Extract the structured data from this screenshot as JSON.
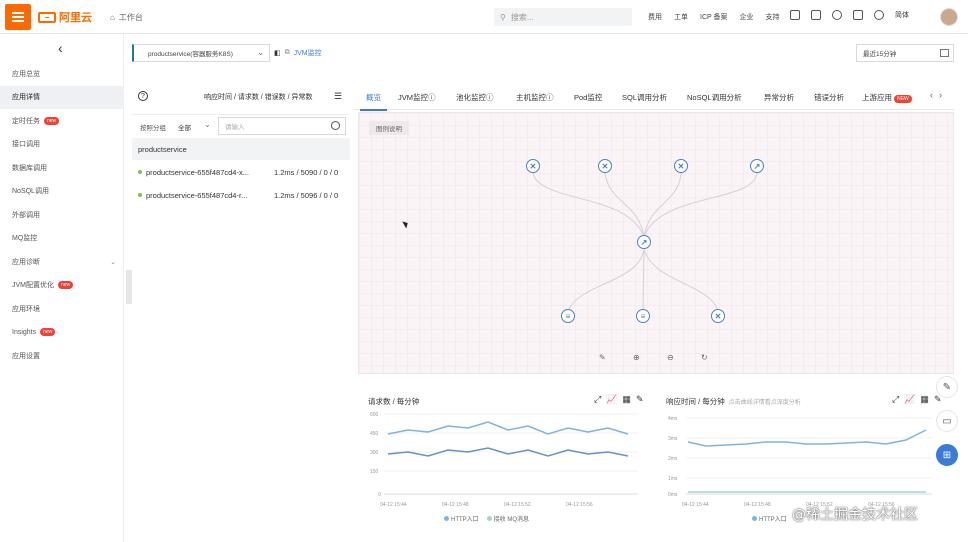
{
  "topbar": {
    "logo_text": "阿里云",
    "workbench": "工作台",
    "search_placeholder": "搜索...",
    "links": [
      "费用",
      "工单",
      "ICP 备案",
      "企业",
      "支持"
    ],
    "lang": "简体"
  },
  "sidebar": {
    "items": [
      {
        "label": "应用总览",
        "badge": "",
        "active": false
      },
      {
        "label": "应用详情",
        "badge": "",
        "active": true
      },
      {
        "label": "定时任务",
        "badge": "new",
        "active": false
      },
      {
        "label": "接口调用",
        "badge": "",
        "active": false
      },
      {
        "label": "数据库调用",
        "badge": "",
        "active": false
      },
      {
        "label": "NoSQL调用",
        "badge": "",
        "active": false
      },
      {
        "label": "外部调用",
        "badge": "",
        "active": false
      },
      {
        "label": "MQ监控",
        "badge": "",
        "active": false
      },
      {
        "label": "应用诊断",
        "badge": "",
        "active": false
      },
      {
        "label": "JVM配置优化",
        "badge": "new",
        "active": false
      },
      {
        "label": "应用环境",
        "badge": "",
        "active": false
      },
      {
        "label": "Insights",
        "badge": "new",
        "active": false
      },
      {
        "label": "应用设置",
        "badge": "",
        "active": false
      }
    ]
  },
  "service_bar": {
    "service_select": "productservice(容器服务K8S)",
    "jvm_link": "JVM监控",
    "time_range": "最近15分钟"
  },
  "left_panel": {
    "columns": "响应时间 / 请求数 / 错误数 / 异常数",
    "group_label": "按照分组",
    "group_value": "全部",
    "search_placeholder": "请输入",
    "service_name": "productservice",
    "instances": [
      {
        "name": "productservice-655f487cd4-x...",
        "metric": "1.2ms / 5090 / 0 / 0"
      },
      {
        "name": "productservice-655f487cd4-r...",
        "metric": "1.2ms / 5096 / 0 / 0"
      }
    ]
  },
  "tabs": [
    "概览",
    "JVM监控",
    "池化监控",
    "主机监控",
    "Pod监控",
    "SQL调用分析",
    "NoSQL调用分析",
    "异常分析",
    "错误分析",
    "上游应用"
  ],
  "tabs_new_badge": "NEW",
  "topology": {
    "legend": "图例说明"
  },
  "charts": {
    "requests": {
      "title": "请求数 / 每分钟",
      "yticks": [
        "600",
        "450",
        "300",
        "150",
        "0"
      ],
      "xticks": [
        "04-12 15:44",
        "04-12 15:48",
        "04-12 15:52",
        "04-12 15:56"
      ],
      "legend": [
        "HTTP入口",
        "接收 MQ消息"
      ],
      "colors": [
        "#7fb3e0",
        "#a8d5c8"
      ]
    },
    "response": {
      "title": "响应时间 / 每分钟",
      "subtitle": "点击曲线详情看点深度分析",
      "yticks": [
        "4ms",
        "3ms",
        "2ms",
        "1ms",
        "0ms"
      ],
      "xticks": [
        "04-12 15:44",
        "04-12 15:48",
        "04-12 15:52",
        "04-12 15:56"
      ],
      "legend": [
        "HTTP入口"
      ],
      "colors": [
        "#7fb3e0",
        "#a8d5c8"
      ]
    }
  },
  "watermark": "@稀土掘金技术社区"
}
